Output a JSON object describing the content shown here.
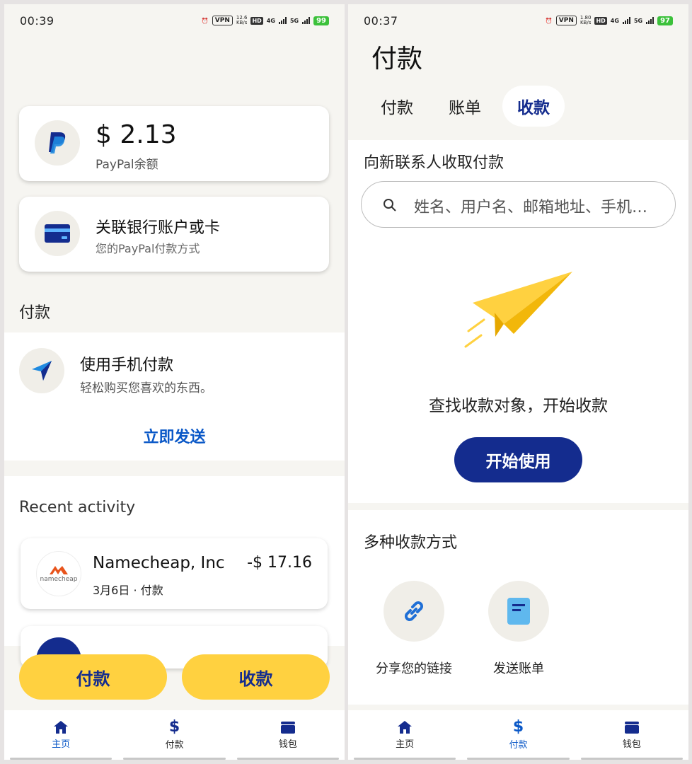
{
  "left": {
    "status": {
      "time": "00:39",
      "vpn": "VPN",
      "speed": "12.6",
      "speed_unit": "KB/s",
      "hd": "HD",
      "net1": "4G",
      "net2": "5G",
      "battery": "99"
    },
    "balance": {
      "amount": "$ 2.13",
      "label": "PayPal余额"
    },
    "link_bank": {
      "title": "关联银行账户或卡",
      "subtitle": "您的PayPal付款方式"
    },
    "pay_section": {
      "heading": "付款",
      "title": "使用手机付款",
      "subtitle": "轻松购买您喜欢的东西。",
      "action": "立即发送"
    },
    "recent": {
      "heading": "Recent activity",
      "items": [
        {
          "logo_text": "namecheap",
          "merchant": "Namecheap, Inc",
          "meta": "3月6日 · 付款",
          "amount": "-$ 17.16"
        }
      ]
    },
    "buttons": {
      "pay": "付款",
      "receive": "收款"
    },
    "nav": [
      {
        "label": "主页",
        "icon": "home-icon"
      },
      {
        "label": "付款",
        "icon": "dollar-icon"
      },
      {
        "label": "钱包",
        "icon": "wallet-icon"
      }
    ]
  },
  "right": {
    "status": {
      "time": "00:37",
      "vpn": "VPN",
      "speed": "1.80",
      "speed_unit": "KB/s",
      "hd": "HD",
      "net1": "4G",
      "net2": "5G",
      "battery": "97"
    },
    "title": "付款",
    "tabs": [
      {
        "label": "付款"
      },
      {
        "label": "账单"
      },
      {
        "label": "收款",
        "selected": true
      }
    ],
    "request": {
      "heading": "向新联系人收取付款",
      "search_placeholder": "姓名、用户名、邮箱地址、手机…",
      "empty_text": "查找收款对象，开始收款",
      "start_button": "开始使用"
    },
    "methods": {
      "heading": "多种收款方式",
      "items": [
        {
          "label": "分享您的链接",
          "icon": "link-icon"
        },
        {
          "label": "发送账单",
          "icon": "invoice-icon"
        }
      ]
    },
    "nav": [
      {
        "label": "主页",
        "icon": "home-icon"
      },
      {
        "label": "付款",
        "icon": "dollar-icon"
      },
      {
        "label": "钱包",
        "icon": "wallet-icon"
      }
    ]
  },
  "colors": {
    "brand_blue": "#142c8e",
    "link_blue": "#0a58c7",
    "yellow": "#ffd140"
  }
}
